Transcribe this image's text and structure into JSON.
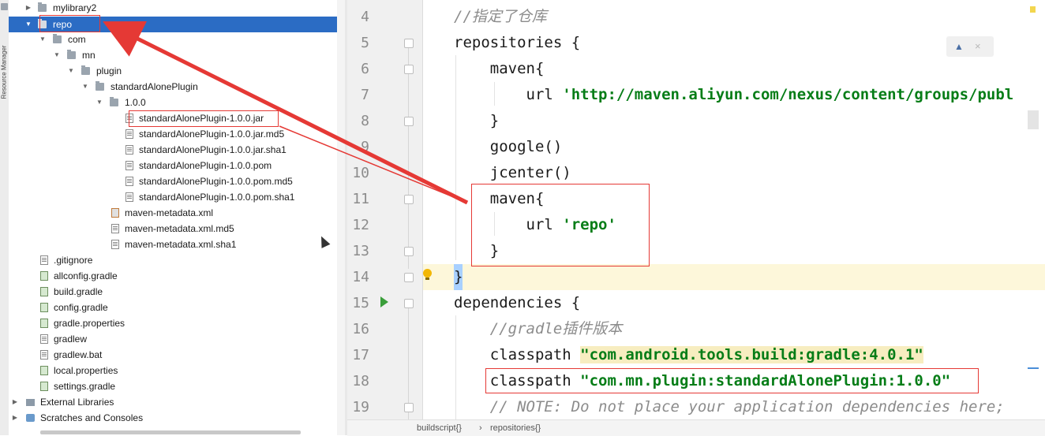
{
  "toolstrip": {
    "resource_manager": "Resource Manager"
  },
  "tree": {
    "items": [
      {
        "label": "mylibrary2"
      },
      {
        "label": "repo"
      },
      {
        "label": "com"
      },
      {
        "label": "mn"
      },
      {
        "label": "plugin"
      },
      {
        "label": "standardAlonePlugin"
      },
      {
        "label": "1.0.0"
      },
      {
        "label": "standardAlonePlugin-1.0.0.jar"
      },
      {
        "label": "standardAlonePlugin-1.0.0.jar.md5"
      },
      {
        "label": "standardAlonePlugin-1.0.0.jar.sha1"
      },
      {
        "label": "standardAlonePlugin-1.0.0.pom"
      },
      {
        "label": "standardAlonePlugin-1.0.0.pom.md5"
      },
      {
        "label": "standardAlonePlugin-1.0.0.pom.sha1"
      },
      {
        "label": "maven-metadata.xml"
      },
      {
        "label": "maven-metadata.xml.md5"
      },
      {
        "label": "maven-metadata.xml.sha1"
      },
      {
        "label": ".gitignore"
      },
      {
        "label": "allconfig.gradle"
      },
      {
        "label": "build.gradle"
      },
      {
        "label": "config.gradle"
      },
      {
        "label": "gradle.properties"
      },
      {
        "label": "gradlew"
      },
      {
        "label": "gradlew.bat"
      },
      {
        "label": "local.properties"
      },
      {
        "label": "settings.gradle"
      },
      {
        "label": "External Libraries"
      },
      {
        "label": "Scratches and Consoles"
      }
    ]
  },
  "editor": {
    "lines": [
      {
        "n": "4",
        "text": "//指定了仓库"
      },
      {
        "n": "5",
        "text": "repositories {"
      },
      {
        "n": "6",
        "text": "    maven{"
      },
      {
        "n": "7",
        "text_a": "        url ",
        "text_b": "'http://maven.aliyun.com/nexus/content/groups/publ"
      },
      {
        "n": "8",
        "text": "    }"
      },
      {
        "n": "9",
        "text": "    google()"
      },
      {
        "n": "10",
        "text": "    jcenter()"
      },
      {
        "n": "11",
        "text": "    maven{"
      },
      {
        "n": "12",
        "text_a": "        url ",
        "text_b": "'repo'"
      },
      {
        "n": "13",
        "text": "    }"
      },
      {
        "n": "14",
        "text": "}"
      },
      {
        "n": "15",
        "text": "dependencies {"
      },
      {
        "n": "16",
        "text": "    //gradle插件版本"
      },
      {
        "n": "17",
        "text_a": "    classpath ",
        "text_b": "\"com.android.tools.build:gradle:4.0.1\""
      },
      {
        "n": "18",
        "text_a": "    classpath ",
        "text_b": "\"com.mn.plugin:standardAlonePlugin:1.0.0\""
      },
      {
        "n": "19",
        "text": "    // NOTE: Do not place your application dependencies here;"
      }
    ]
  },
  "breadcrumb": {
    "first": "buildscript{}",
    "sep": "›",
    "second": "repositories{}"
  },
  "colors": {
    "selection": "#2b6cc4",
    "annotation": "#e53935",
    "string": "#067d17",
    "current_line": "#fdf7da"
  }
}
